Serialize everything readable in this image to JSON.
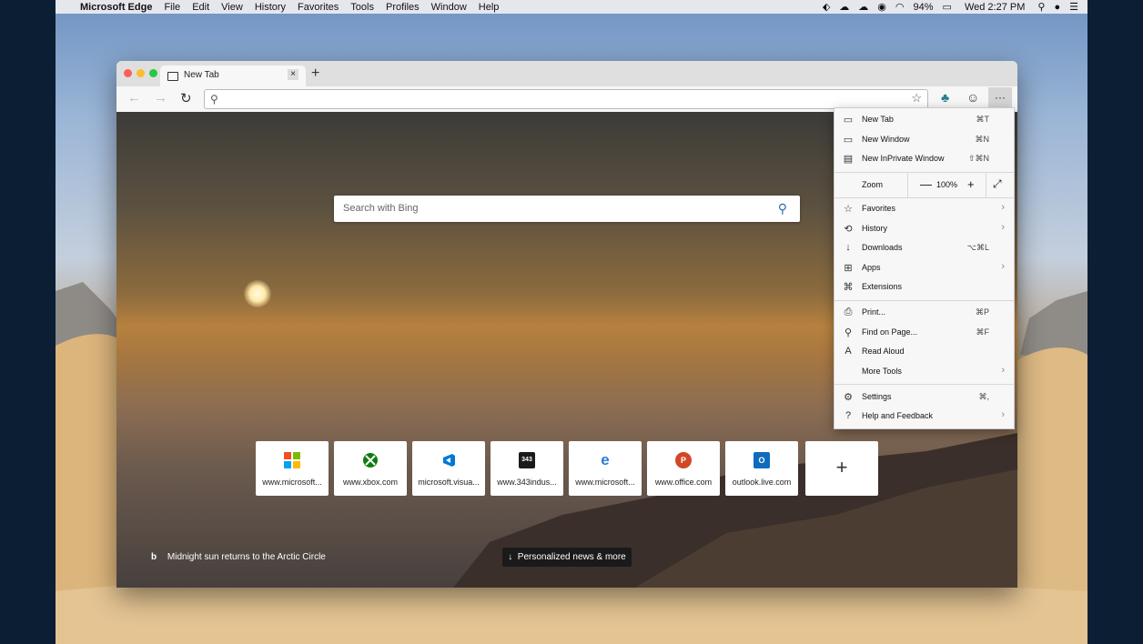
{
  "menubar": {
    "apple": "",
    "app_name": "Microsoft Edge",
    "items": [
      "File",
      "Edit",
      "View",
      "History",
      "Favorites",
      "Tools",
      "Profiles",
      "Window",
      "Help"
    ],
    "battery": "94%",
    "clock": "Wed 2:27 PM"
  },
  "browser": {
    "tab_title": "New Tab",
    "tab_close": "×",
    "new_tab": "+",
    "address_value": "",
    "more_label": "···"
  },
  "newtab": {
    "search_placeholder": "Search with Bing",
    "tiles": [
      {
        "label": "www.microsoft...",
        "logo_text": "",
        "color": "#ffffff"
      },
      {
        "label": "www.xbox.com",
        "logo_text": "",
        "color": "#ffffff"
      },
      {
        "label": "microsoft.visua...",
        "logo_text": "",
        "color": "#ffffff"
      },
      {
        "label": "www.343indus...",
        "logo_text": "343",
        "color": "#1b1b1b"
      },
      {
        "label": "www.microsoft...",
        "logo_text": "e",
        "color": "#ffffff"
      },
      {
        "label": "www.office.com",
        "logo_text": "P",
        "color": "#d24726"
      },
      {
        "label": "outlook.live.com",
        "logo_text": "O",
        "color": "#0f6cbd"
      }
    ],
    "add_tile": "+",
    "image_caption": "Midnight sun returns to the Arctic Circle",
    "bing_mark": "b",
    "news_button": "Personalized news & more"
  },
  "menu": {
    "items_top": [
      {
        "label": "New Tab",
        "shortcut": "⌘T",
        "icon": "new-tab-icon"
      },
      {
        "label": "New Window",
        "shortcut": "⌘N",
        "icon": "new-window-icon"
      },
      {
        "label": "New InPrivate Window",
        "shortcut": "⇧⌘N",
        "icon": "inprivate-icon"
      }
    ],
    "zoom_label": "Zoom",
    "zoom_minus": "—",
    "zoom_value": "100%",
    "zoom_plus": "+",
    "zoom_full": "⤢",
    "items_mid": [
      {
        "label": "Favorites",
        "shortcut": "",
        "arrow": true,
        "icon": "star-icon"
      },
      {
        "label": "History",
        "shortcut": "",
        "arrow": true,
        "icon": "history-icon"
      },
      {
        "label": "Downloads",
        "shortcut": "⌥⌘L",
        "arrow": false,
        "icon": "download-icon"
      },
      {
        "label": "Apps",
        "shortcut": "",
        "arrow": true,
        "icon": "apps-icon"
      },
      {
        "label": "Extensions",
        "shortcut": "",
        "arrow": false,
        "icon": "extensions-icon"
      }
    ],
    "items_tools": [
      {
        "label": "Print...",
        "shortcut": "⌘P",
        "arrow": false,
        "icon": "print-icon"
      },
      {
        "label": "Find on Page...",
        "shortcut": "⌘F",
        "arrow": false,
        "icon": "find-icon"
      },
      {
        "label": "Read Aloud",
        "shortcut": "",
        "arrow": false,
        "icon": "read-aloud-icon"
      },
      {
        "label": "More Tools",
        "shortcut": "",
        "arrow": true,
        "icon": ""
      }
    ],
    "items_bottom": [
      {
        "label": "Settings",
        "shortcut": "⌘,",
        "arrow": false,
        "icon": "gear-icon"
      },
      {
        "label": "Help and Feedback",
        "shortcut": "",
        "arrow": true,
        "icon": "help-icon"
      }
    ]
  }
}
